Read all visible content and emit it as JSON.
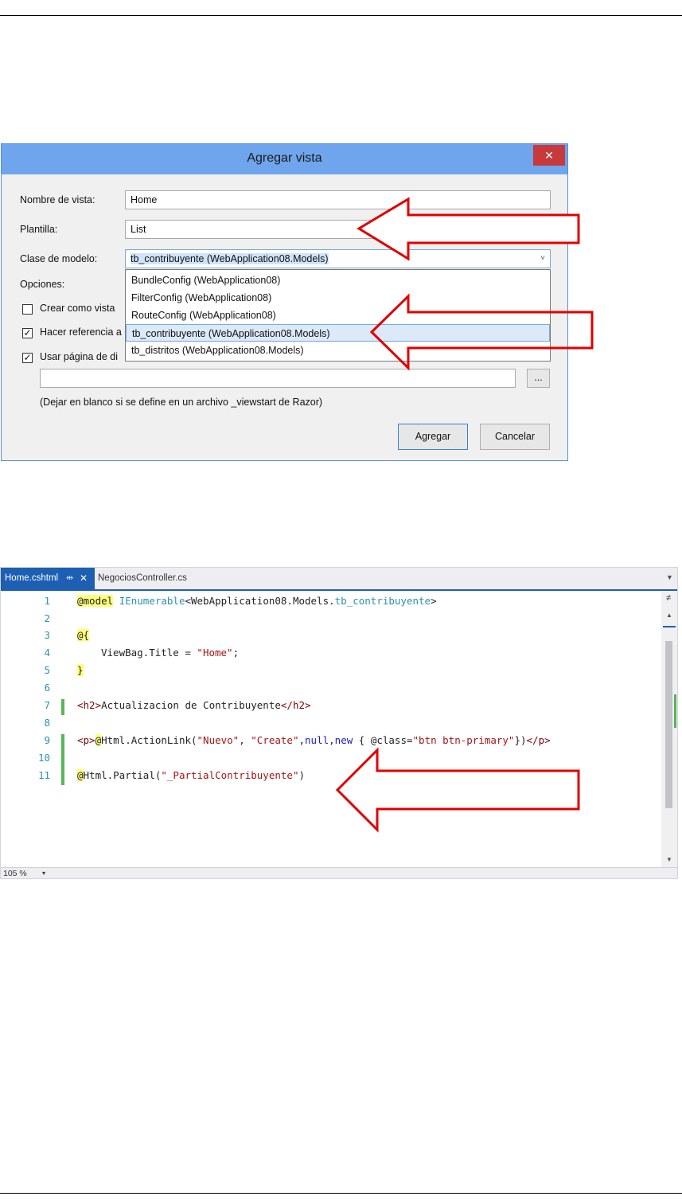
{
  "dialog": {
    "title": "Agregar vista",
    "close_label": "✕",
    "nombre_label": "Nombre de vista:",
    "nombre_value": "Home",
    "plantilla_label": "Plantilla:",
    "plantilla_value": "List",
    "clase_label": "Clase de modelo:",
    "clase_value": "tb_contribuyente (WebApplication08.Models)",
    "opciones_label": "Opciones:",
    "crear_label": "Crear como vista",
    "hacer_label": "Hacer referencia a",
    "usar_label": "Usar página de di",
    "hacer_checked": true,
    "usar_checked": true,
    "crear_checked": false,
    "layout_value": "",
    "browse_label": "...",
    "hint": "(Dejar en blanco si se define en un archivo _viewstart de Razor)",
    "agregar_label": "Agregar",
    "cancelar_label": "Cancelar",
    "dropdown_options": [
      "BundleConfig (WebApplication08)",
      "FilterConfig (WebApplication08)",
      "RouteConfig (WebApplication08)",
      "tb_contribuyente (WebApplication08.Models)",
      "tb_distritos (WebApplication08.Models)"
    ],
    "dropdown_selected_index": 3
  },
  "editor": {
    "tabs": {
      "active": "Home.cshtml",
      "pin": "⇹",
      "close": "✕",
      "inactive": "NegociosController.cs"
    },
    "line_numbers": [
      "1",
      "2",
      "3",
      "4",
      "5",
      "6",
      "7",
      "8",
      "9",
      "10",
      "11"
    ],
    "lines": {
      "l1_directive": "@model",
      "l1_type": "IEnumerable",
      "l1_generic": "<WebApplication08.Models.",
      "l1_model": "tb_contribuyente",
      "l1_end": ">",
      "l3_open": "@{",
      "l4_code": "ViewBag.Title = ",
      "l4_str": "\"Home\"",
      "l4_end": ";",
      "l5_close": "}",
      "l7_open": "<h2>",
      "l7_text": "Actualizacion de Contribuyente",
      "l7_close": "</h2>",
      "l9_open": "<p>",
      "l9_at": "@",
      "l9_call": "Html.ActionLink(",
      "l9_s1": "\"Nuevo\"",
      "l9_sep1": ", ",
      "l9_s2": "\"Create\"",
      "l9_sep2": ",",
      "l9_null": "null",
      "l9_sep3": ",",
      "l9_new": "new",
      "l9_brace": " { @class=",
      "l9_s3": "\"btn btn-primary\"",
      "l9_end": "})",
      "l9_close": "</p>",
      "l11_at": "@",
      "l11_call": "Html.Partial(",
      "l11_str": "\"_PartialContribuyente\"",
      "l11_end": ")"
    },
    "zoom": "105 %",
    "zoom_arrow": "▾"
  },
  "colors": {
    "titlebar": "#6ea5ec",
    "close": "#c7393a",
    "arrow_stroke": "#e00000",
    "tab_active": "#1d5fb3"
  },
  "icons": [
    "close-icon",
    "chevron-down-icon",
    "checkbox-icon",
    "red-arrow-icon",
    "pin-icon",
    "scroll-up-icon",
    "scroll-down-icon"
  ]
}
